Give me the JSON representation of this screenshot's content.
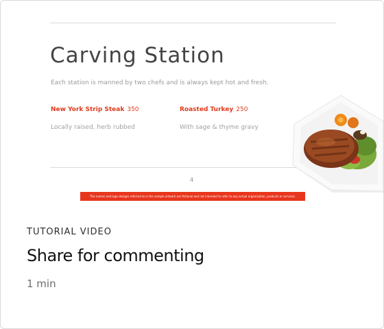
{
  "thumbnail": {
    "title": "Carving Station",
    "subtitle": "Each station is manned by two chefs and is always kept hot and fresh.",
    "items": [
      {
        "name": "New York Strip Steak",
        "price": "350",
        "description": "Locally raised, herb rubbed"
      },
      {
        "name": "Roasted Turkey",
        "price": "250",
        "description": "With sage & thyme gravy"
      }
    ],
    "page_number": "4",
    "disclaimer": "The names and logo designs referred to in the sample artwork are fictional and not intended to refer to any actual organization, products or services.",
    "image_icon": "steak-plate-image",
    "accent_color": "#e8361d"
  },
  "card": {
    "category": "TUTORIAL VIDEO",
    "title": "Share for commenting",
    "duration": "1 min"
  }
}
